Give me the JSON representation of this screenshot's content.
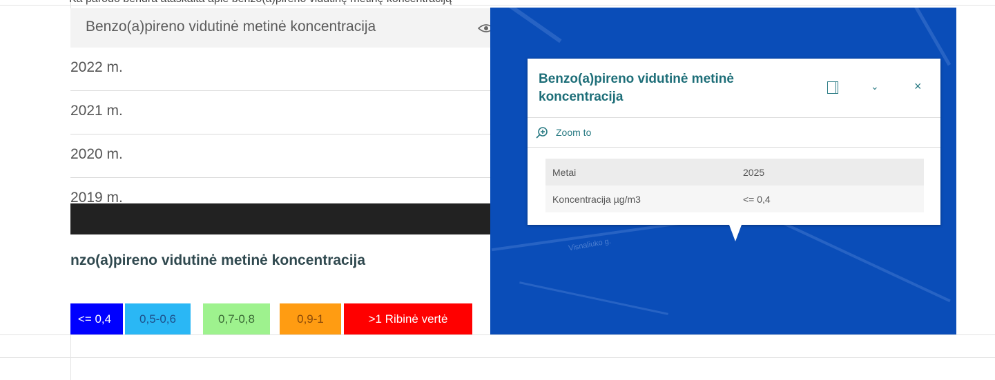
{
  "top_caption": "Ka parodo bendra ataskaita apie benzo(a)pireno vidutinę metinę koncentraciją",
  "left_panel": {
    "layer_title": "Benzo(a)pireno vidutinė metinė koncentracija",
    "years": [
      "2022 m.",
      "2021 m.",
      "2020 m.",
      "2019 m."
    ],
    "legend_title": "nzo(a)pireno vidutinė metinė koncentracija",
    "legend_chips": [
      {
        "label": "<= 0,4",
        "bg": "#0000ff",
        "fg": "#ffffff"
      },
      {
        "label": "0,5-0,6",
        "bg": "#2ab7f5",
        "fg": "#1e4f8a"
      },
      {
        "label": "0,7-0,8",
        "bg": "#9ef28e",
        "fg": "#3a6a36"
      },
      {
        "label": "0,9-1",
        "bg": "#ff9c12",
        "fg": "#8a4a0a"
      },
      {
        "label": ">1 Ribinė vertė",
        "bg": "#ff0000",
        "fg": "#ffffff"
      }
    ]
  },
  "map": {
    "street_label": "Visnaliuko g.",
    "popup": {
      "title": "Benzo(a)pireno vidutinė metinė koncentracija",
      "zoom_label": "Zoom to",
      "rows": [
        {
          "key": "Metai",
          "value": "2025"
        },
        {
          "key": "Koncentracija µg/m3",
          "value": "<= 0,4"
        }
      ]
    }
  },
  "colors": {
    "map_bg": "#0a4db8",
    "accent_teal": "#1d6e78"
  }
}
